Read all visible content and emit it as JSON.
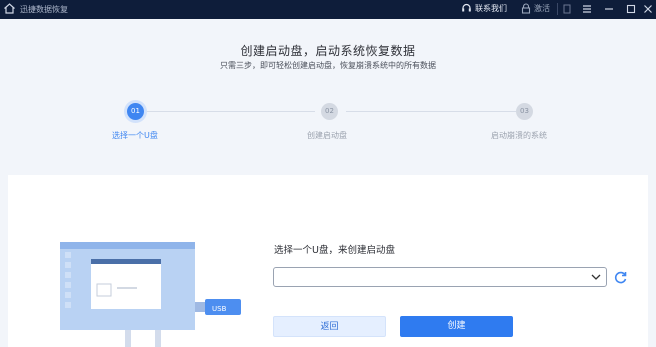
{
  "titlebar": {
    "app_title": "迅捷数据恢复",
    "contact_label": "联系我们",
    "activate_label": "激活"
  },
  "header": {
    "title": "创建启动盘，启动系统恢复数据",
    "subtitle": "只需三步，即可轻松创建启动盘，恢复崩溃系统中的所有数据"
  },
  "steps": [
    {
      "number": "01",
      "label": "选择一个U盘",
      "active": true
    },
    {
      "number": "02",
      "label": "创建启动盘",
      "active": false
    },
    {
      "number": "03",
      "label": "启动崩溃的系统",
      "active": false
    }
  ],
  "form": {
    "prompt": "选择一个U盘，来创建启动盘",
    "usb_select_value": "",
    "usb_label": "USB"
  },
  "buttons": {
    "back_label": "返回",
    "create_label": "创建"
  },
  "colors": {
    "accent": "#2f7bf0",
    "titlebar_bg": "#0e1d3a",
    "step_inactive": "#d4d9e2"
  }
}
